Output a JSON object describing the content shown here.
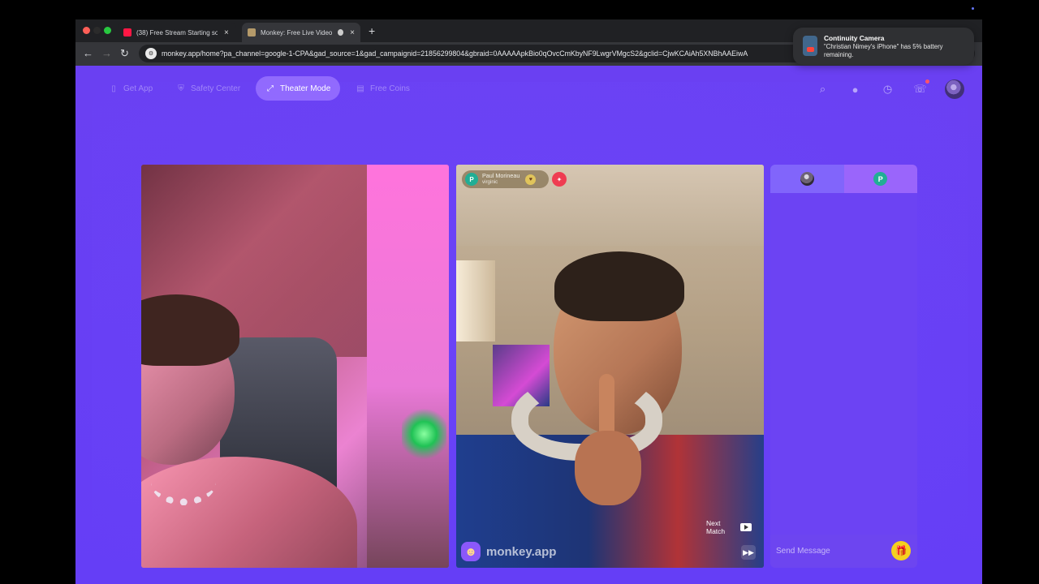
{
  "browser": {
    "tabs": [
      {
        "label": "(38) Free Stream Starting so",
        "close": "×"
      },
      {
        "label": "Monkey: Free Live Video ",
        "close": "×"
      }
    ],
    "new_tab": "+",
    "url": "monkey.app/home?pa_channel=google-1-CPA&gad_source=1&gad_campaignid=21856299804&gbraid=0AAAAApkBio0qOvcCmKbyNF9LwgrVMgcS2&gclid=CjwKCAiAh5XNBhAAEiwA"
  },
  "notification": {
    "title": "Continuity Camera",
    "body": "\"Christian Nimey's iPhone\" has 5% battery remaining."
  },
  "nav": {
    "get_app": "Get App",
    "safety_center": "Safety Center",
    "theater_mode": "Theater Mode",
    "free_coins": "Free Coins"
  },
  "match": {
    "name": "Paul Morineau",
    "location": "virginic",
    "next_match": "Next Match",
    "watermark": "monkey.app"
  },
  "chat": {
    "avatar_initial": "P",
    "send_placeholder": "Send Message"
  },
  "colors": {
    "page_bg": "#6a40f2",
    "accent": "#21ae95",
    "gift": "#f5d11f"
  }
}
